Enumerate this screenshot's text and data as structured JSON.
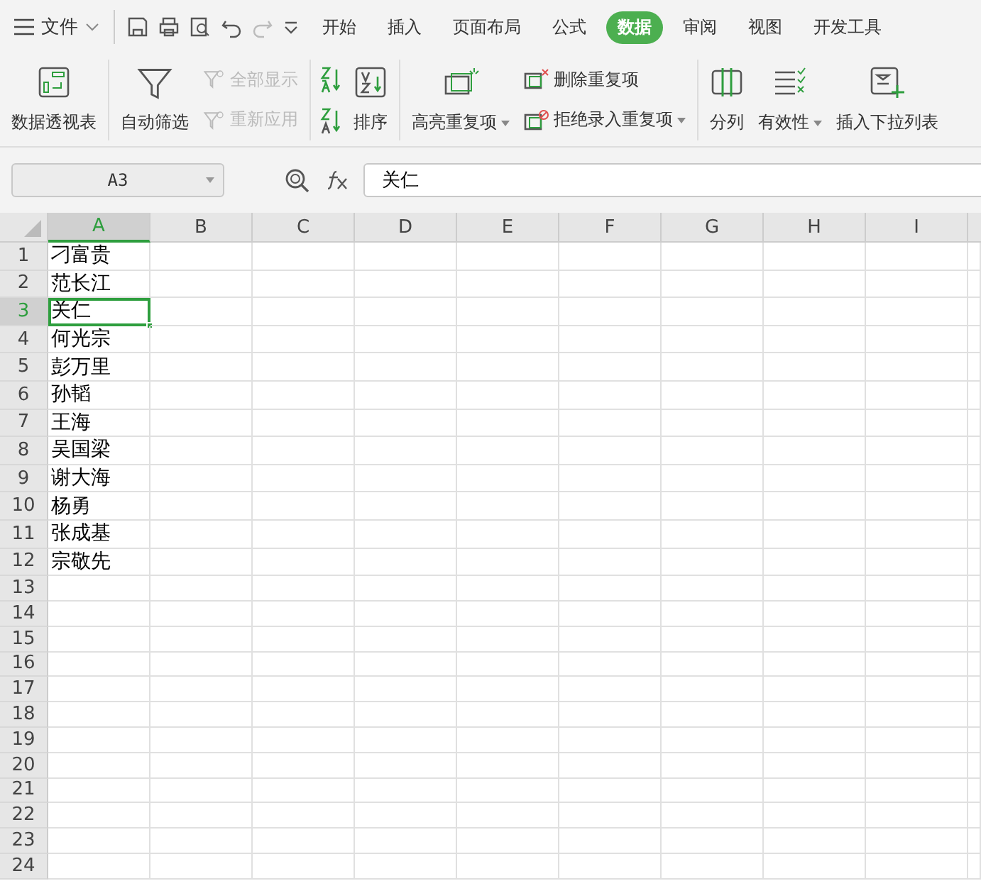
{
  "menu": {
    "file_label": "文件"
  },
  "tabs": [
    {
      "label": "开始",
      "selected": false
    },
    {
      "label": "插入",
      "selected": false
    },
    {
      "label": "页面布局",
      "selected": false
    },
    {
      "label": "公式",
      "selected": false
    },
    {
      "label": "数据",
      "selected": true
    },
    {
      "label": "审阅",
      "selected": false
    },
    {
      "label": "视图",
      "selected": false
    },
    {
      "label": "开发工具",
      "selected": false
    }
  ],
  "ribbon_groups": [
    {
      "items": [
        {
          "kind": "large",
          "label": "数据透视表",
          "dropdown": false,
          "disabled": false
        }
      ]
    },
    {
      "items": [
        {
          "kind": "large",
          "label": "自动筛选",
          "dropdown": false,
          "disabled": false
        },
        {
          "kind": "stack",
          "entries": [
            {
              "label": "全部显示",
              "dropdown": false,
              "disabled": true
            },
            {
              "label": "重新应用",
              "dropdown": false,
              "disabled": true
            }
          ]
        }
      ]
    },
    {
      "items": [
        {
          "kind": "iconstack"
        },
        {
          "kind": "large",
          "label": "排序",
          "dropdown": false,
          "disabled": false
        }
      ]
    },
    {
      "items": [
        {
          "kind": "large",
          "label": "高亮重复项",
          "dropdown": true,
          "disabled": false
        },
        {
          "kind": "stack",
          "entries": [
            {
              "label": "删除重复项",
              "dropdown": false,
              "disabled": false
            },
            {
              "label": "拒绝录入重复项",
              "dropdown": true,
              "disabled": false
            }
          ]
        }
      ]
    },
    {
      "items": [
        {
          "kind": "large",
          "label": "分列",
          "dropdown": false,
          "disabled": false
        },
        {
          "kind": "large",
          "label": "有效性",
          "dropdown": true,
          "disabled": false
        },
        {
          "kind": "large",
          "label": "插入下拉列表",
          "dropdown": false,
          "disabled": false
        }
      ]
    }
  ],
  "name_box": "A3",
  "formula": "关仁",
  "columns": [
    {
      "label": "A",
      "selected": true
    },
    {
      "label": "B",
      "selected": false
    },
    {
      "label": "C",
      "selected": false
    },
    {
      "label": "D",
      "selected": false
    },
    {
      "label": "E",
      "selected": false
    },
    {
      "label": "F",
      "selected": false
    },
    {
      "label": "G",
      "selected": false
    },
    {
      "label": "H",
      "selected": false
    },
    {
      "label": "I",
      "selected": false
    }
  ],
  "rows": [
    {
      "number": "1",
      "selected": false,
      "cells": [
        "刁富贵"
      ]
    },
    {
      "number": "2",
      "selected": false,
      "cells": [
        "范长江"
      ]
    },
    {
      "number": "3",
      "selected": true,
      "cells": [
        "关仁"
      ]
    },
    {
      "number": "4",
      "selected": false,
      "cells": [
        "何光宗"
      ]
    },
    {
      "number": "5",
      "selected": false,
      "cells": [
        "彭万里"
      ]
    },
    {
      "number": "6",
      "selected": false,
      "cells": [
        "孙韬"
      ]
    },
    {
      "number": "7",
      "selected": false,
      "cells": [
        "王海"
      ]
    },
    {
      "number": "8",
      "selected": false,
      "cells": [
        "吴国梁"
      ]
    },
    {
      "number": "9",
      "selected": false,
      "cells": [
        "谢大海"
      ]
    },
    {
      "number": "10",
      "selected": false,
      "cells": [
        "杨勇"
      ]
    },
    {
      "number": "11",
      "selected": false,
      "cells": [
        "张成基"
      ]
    },
    {
      "number": "12",
      "selected": false,
      "cells": [
        "宗敬先"
      ]
    },
    {
      "number": "13",
      "selected": false
    },
    {
      "number": "14",
      "selected": false
    },
    {
      "number": "15",
      "selected": false
    },
    {
      "number": "16",
      "selected": false
    },
    {
      "number": "17",
      "selected": false
    },
    {
      "number": "18",
      "selected": false
    },
    {
      "number": "19",
      "selected": false
    },
    {
      "number": "20",
      "selected": false
    },
    {
      "number": "21",
      "selected": false
    },
    {
      "number": "22",
      "selected": false
    },
    {
      "number": "23",
      "selected": false
    },
    {
      "number": "24",
      "selected": false
    }
  ]
}
